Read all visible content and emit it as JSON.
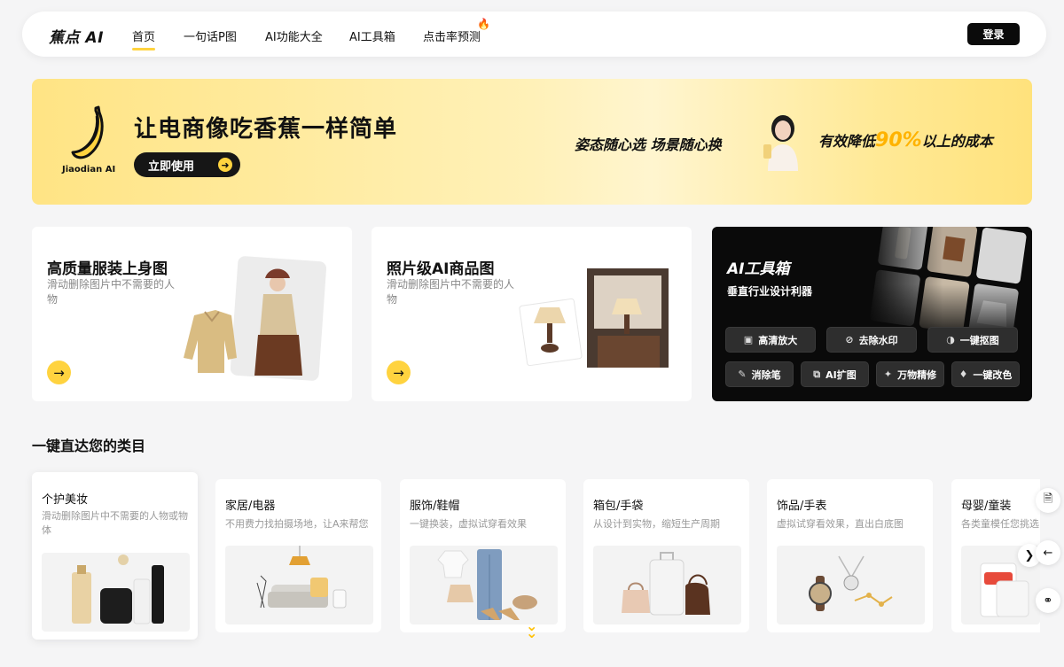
{
  "nav": {
    "logo": "蕉点 AI",
    "items": [
      {
        "label": "首页",
        "active": true
      },
      {
        "label": "一句话P图"
      },
      {
        "label": "AI功能大全"
      },
      {
        "label": "AI工具箱"
      },
      {
        "label": "点击率预测",
        "badge_icon": "fire-icon"
      }
    ],
    "login": "登录"
  },
  "banner": {
    "brand_text": "Jiaodian AI",
    "title": "让电商像吃香蕉一样简单",
    "cta": "立即使用",
    "slogan_left": "姿态随心选 场景随心换",
    "slogan_right_prefix": "有效降低",
    "slogan_right_pct": "90%",
    "slogan_right_suffix": "以上的成本",
    "accent": "#ffd33f"
  },
  "features": [
    {
      "title": "高质量服装上身图",
      "desc": "滑动删除图片中不需要的人物"
    },
    {
      "title": "照片级AI商品图",
      "desc": "滑动删除图片中不需要的人物"
    }
  ],
  "toolbox": {
    "title": "AI工具箱",
    "subtitle": "垂直行业设计利器",
    "tools": [
      {
        "label": "高清放大",
        "icon": "upscale-icon"
      },
      {
        "label": "去除水印",
        "icon": "remove-watermark-icon"
      },
      {
        "label": "一键抠图",
        "icon": "cutout-icon"
      },
      {
        "label": "消除笔",
        "icon": "eraser-pen-icon"
      },
      {
        "label": "AI扩图",
        "icon": "expand-icon"
      },
      {
        "label": "万物精修",
        "icon": "magic-wand-icon"
      },
      {
        "label": "一键改色",
        "icon": "recolor-icon"
      }
    ]
  },
  "categories": {
    "section_title": "一键直达您的类目",
    "items": [
      {
        "title": "个护美妆",
        "desc": "滑动删除图片中不需要的人物或物体"
      },
      {
        "title": "家居/电器",
        "desc": "不用费力找拍摄场地，让A来帮您"
      },
      {
        "title": "服饰/鞋帽",
        "desc": "一键换装，虚拟试穿看效果"
      },
      {
        "title": "箱包/手袋",
        "desc": "从设计到实物，缩短生产周期"
      },
      {
        "title": "饰品/手表",
        "desc": "虚拟试穿看效果，直出白底图"
      },
      {
        "title": "母婴/童装",
        "desc": "各类童模任您挑选"
      }
    ]
  }
}
